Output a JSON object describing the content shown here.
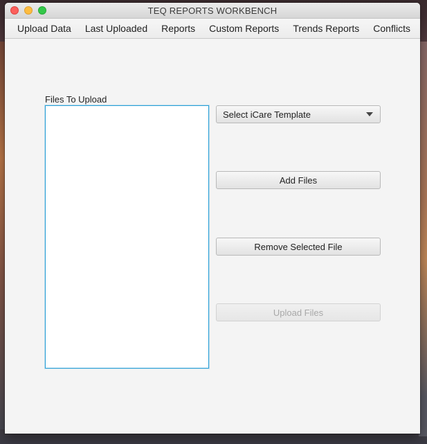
{
  "window": {
    "title": "TEQ REPORTS WORKBENCH"
  },
  "menu": {
    "items": [
      {
        "label": "Upload Data"
      },
      {
        "label": "Last Uploaded"
      },
      {
        "label": "Reports"
      },
      {
        "label": "Custom Reports"
      },
      {
        "label": "Trends Reports"
      },
      {
        "label": "Conflicts"
      }
    ]
  },
  "upload": {
    "files_label": "Files To Upload",
    "template_select": {
      "selected": "Select iCare Template",
      "icon": "chevron-down-icon"
    },
    "add_files_label": "Add Files",
    "remove_file_label": "Remove Selected File",
    "upload_files_label": "Upload Files",
    "upload_files_enabled": false
  },
  "colors": {
    "list_focus_border": "#2a9fd6",
    "close": "#fc605c",
    "minimize": "#fdbc40",
    "zoom": "#34c84a"
  }
}
